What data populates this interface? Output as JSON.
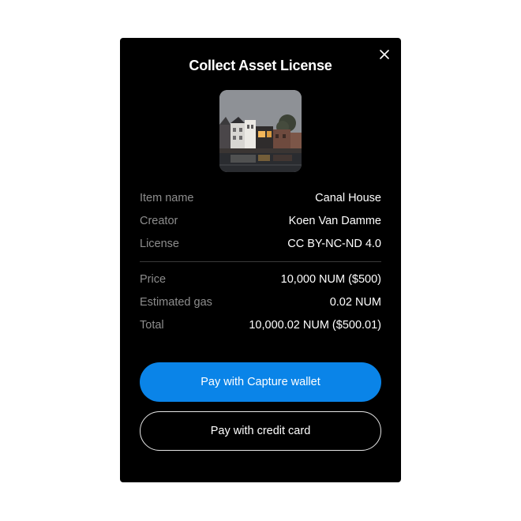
{
  "modal": {
    "title": "Collect Asset License",
    "close_icon": "close-icon"
  },
  "asset": {
    "thumbnail_icon": "asset-thumbnail"
  },
  "details": [
    {
      "label": "Item name",
      "value": "Canal House"
    },
    {
      "label": "Creator",
      "value": "Koen Van Damme"
    },
    {
      "label": "License",
      "value": "CC BY-NC-ND 4.0"
    }
  ],
  "costs": [
    {
      "label": "Price",
      "value": "10,000 NUM ($500)"
    },
    {
      "label": "Estimated gas",
      "value": "0.02 NUM"
    },
    {
      "label": "Total",
      "value": "10,000.02 NUM ($500.01)"
    }
  ],
  "actions": {
    "primary_label": "Pay with Capture wallet",
    "secondary_label": "Pay with credit card"
  },
  "colors": {
    "modal_bg": "#000000",
    "accent": "#0a84e8",
    "label_text": "#8d8d8d",
    "value_text": "#ffffff"
  }
}
